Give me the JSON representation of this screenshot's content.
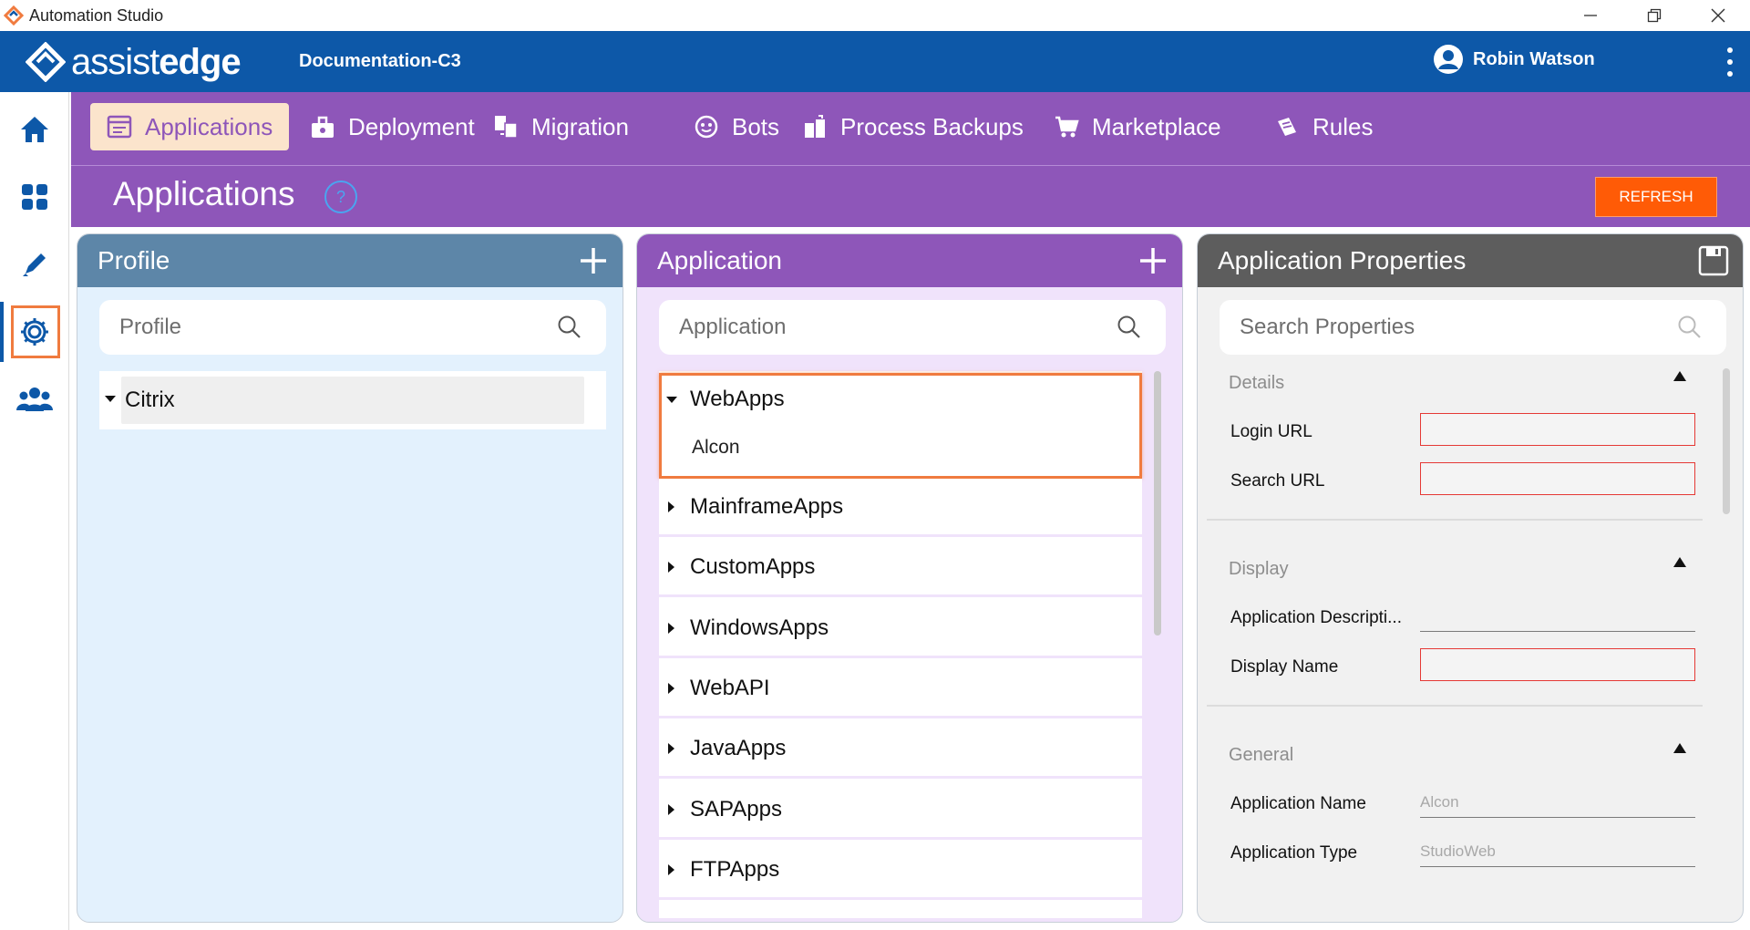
{
  "window": {
    "title": "Automation Studio"
  },
  "header": {
    "brand_thin": "assist",
    "brand_bold": "edge",
    "project": "Documentation-C3",
    "user": "Robin Watson"
  },
  "rail": {
    "items": [
      {
        "icon": "home-icon"
      },
      {
        "icon": "dashboard-icon"
      },
      {
        "icon": "pencil-icon"
      },
      {
        "icon": "gear-icon",
        "active": true
      },
      {
        "icon": "users-icon"
      }
    ]
  },
  "nav": {
    "items": [
      {
        "label": "Applications",
        "icon": "applications-icon",
        "active": true
      },
      {
        "label": "Deployment",
        "icon": "deployment-icon"
      },
      {
        "label": "Migration",
        "icon": "migration-icon"
      },
      {
        "label": "Bots",
        "icon": "bots-icon"
      },
      {
        "label": "Process Backups",
        "icon": "process-backups-icon"
      },
      {
        "label": "Marketplace",
        "icon": "marketplace-icon"
      },
      {
        "label": "Rules",
        "icon": "rules-icon"
      }
    ]
  },
  "page": {
    "title": "Applications",
    "help": "?",
    "refresh": "REFRESH"
  },
  "profile_panel": {
    "title": "Profile",
    "search_placeholder": "Profile",
    "items": [
      {
        "label": "Citrix",
        "expanded": true
      }
    ]
  },
  "app_panel": {
    "title": "Application",
    "search_placeholder": "Application",
    "groups": [
      {
        "label": "WebApps",
        "expanded": true,
        "children": [
          "Alcon"
        ]
      },
      {
        "label": "MainframeApps"
      },
      {
        "label": "CustomApps"
      },
      {
        "label": "WindowsApps"
      },
      {
        "label": "WebAPI"
      },
      {
        "label": "JavaApps"
      },
      {
        "label": "SAPApps"
      },
      {
        "label": "FTPApps"
      }
    ]
  },
  "props_panel": {
    "title": "Application Properties",
    "search_placeholder": "Search Properties",
    "sections": [
      {
        "title": "Details",
        "fields": [
          {
            "label": "Login URL",
            "value": "",
            "required": true
          },
          {
            "label": "Search URL",
            "value": "",
            "required": true
          }
        ]
      },
      {
        "title": "Display",
        "fields": [
          {
            "label": "Application Descripti...",
            "value": "",
            "required": false
          },
          {
            "label": "Display Name",
            "value": "",
            "required": true
          }
        ]
      },
      {
        "title": "General",
        "fields": [
          {
            "label": "Application Name",
            "value": "Alcon",
            "required": false
          },
          {
            "label": "Application Type",
            "value": "StudioWeb",
            "required": false
          }
        ]
      }
    ]
  },
  "colors": {
    "brand_blue": "#0d58a8",
    "nav_purple": "#8e56b9",
    "refresh_orange": "#ff5b06",
    "highlight_orange": "#f07b3f"
  }
}
